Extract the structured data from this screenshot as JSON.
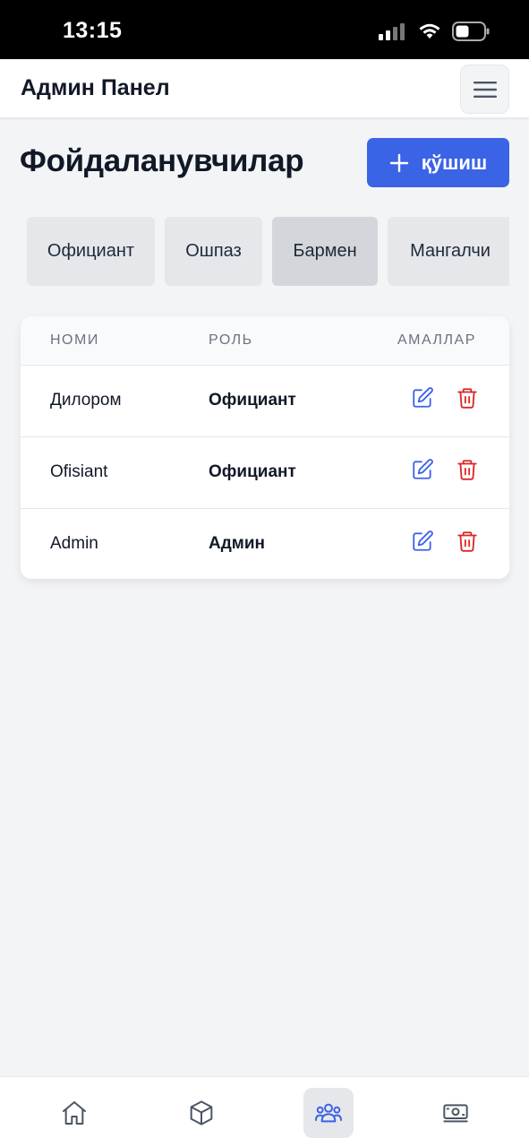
{
  "status_bar": {
    "time": "13:15"
  },
  "header": {
    "title": "Админ Панел"
  },
  "page": {
    "title": "Фойдаланувчилар",
    "add_button_label": "қўшиш"
  },
  "filters": [
    {
      "label": "Официант",
      "active": false
    },
    {
      "label": "Ошпаз",
      "active": false
    },
    {
      "label": "Бармен",
      "active": true
    },
    {
      "label": "Мангалчи",
      "active": false
    }
  ],
  "table": {
    "columns": [
      "НОМИ",
      "РОЛЬ",
      "АМАЛЛАР"
    ],
    "rows": [
      {
        "name": "Дилором",
        "role": "Официант"
      },
      {
        "name": "Ofisiant",
        "role": "Официант"
      },
      {
        "name": "Admin",
        "role": "Админ"
      }
    ]
  },
  "bottom_nav": [
    {
      "icon": "home-icon",
      "active": false
    },
    {
      "icon": "cube-icon",
      "active": false
    },
    {
      "icon": "users-icon",
      "active": true
    },
    {
      "icon": "money-icon",
      "active": false
    }
  ],
  "colors": {
    "primary": "#3b63e6",
    "danger": "#dc2626",
    "edit": "#3b63e6"
  }
}
